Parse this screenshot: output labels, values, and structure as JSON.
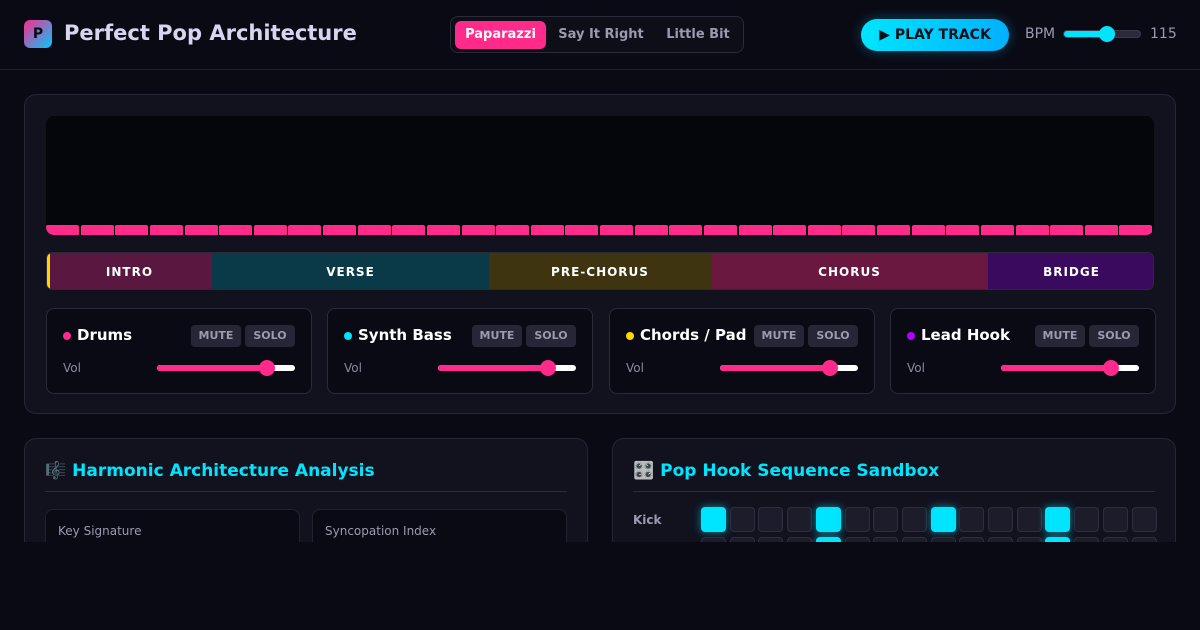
{
  "app": {
    "logo_letter": "P",
    "title": "Perfect Pop Architecture"
  },
  "tracks": [
    {
      "label": "Paparazzi",
      "active": true
    },
    {
      "label": "Say It Right",
      "active": false
    },
    {
      "label": "Little Bit",
      "active": false
    }
  ],
  "transport": {
    "play_label": "▶ PLAY TRACK",
    "bpm_label": "BPM",
    "bpm_value": "115",
    "bpm_slider_fraction": 0.56
  },
  "waveform": {
    "bar_count": 32,
    "color": "#ff2a8a"
  },
  "sections": [
    {
      "label": "INTRO",
      "color": "#5a1840"
    },
    {
      "label": "VERSE",
      "color": "#0a3a48"
    },
    {
      "label": "PRE-CHORUS",
      "color": "#3e3410"
    },
    {
      "label": "CHORUS",
      "color": "#6a1840"
    },
    {
      "label": "BRIDGE",
      "color": "#3a0a5e"
    }
  ],
  "channels": [
    {
      "name": "Drums",
      "dot_color": "#ff2a8a",
      "mute_label": "MUTE",
      "solo_label": "SOLO",
      "vol_label": "Vol",
      "volume": 0.8
    },
    {
      "name": "Synth Bass",
      "dot_color": "#00e5ff",
      "mute_label": "MUTE",
      "solo_label": "SOLO",
      "vol_label": "Vol",
      "volume": 0.8
    },
    {
      "name": "Chords / Pad",
      "dot_color": "#ffd600",
      "mute_label": "MUTE",
      "solo_label": "SOLO",
      "vol_label": "Vol",
      "volume": 0.8
    },
    {
      "name": "Lead Hook",
      "dot_color": "#b000ff",
      "mute_label": "MUTE",
      "solo_label": "SOLO",
      "vol_label": "Vol",
      "volume": 0.8
    }
  ],
  "harmonic_panel": {
    "icon": "🎼",
    "title": "Harmonic Architecture Analysis",
    "stats": [
      {
        "label": "Key Signature"
      },
      {
        "label": "Syncopation Index"
      }
    ]
  },
  "sequencer_panel": {
    "icon": "🎛️",
    "title": "Pop Hook Sequence Sandbox",
    "rows": [
      {
        "label": "Kick",
        "steps": [
          1,
          0,
          0,
          0,
          1,
          0,
          0,
          0,
          1,
          0,
          0,
          0,
          1,
          0,
          0,
          0
        ]
      },
      {
        "label": "",
        "steps": [
          0,
          0,
          0,
          0,
          1,
          0,
          0,
          0,
          0,
          0,
          0,
          0,
          1,
          0,
          0,
          0
        ]
      }
    ]
  },
  "colors": {
    "accent_pink": "#ff2a8a",
    "accent_cyan": "#00e5ff",
    "background": "#0a0a14"
  }
}
